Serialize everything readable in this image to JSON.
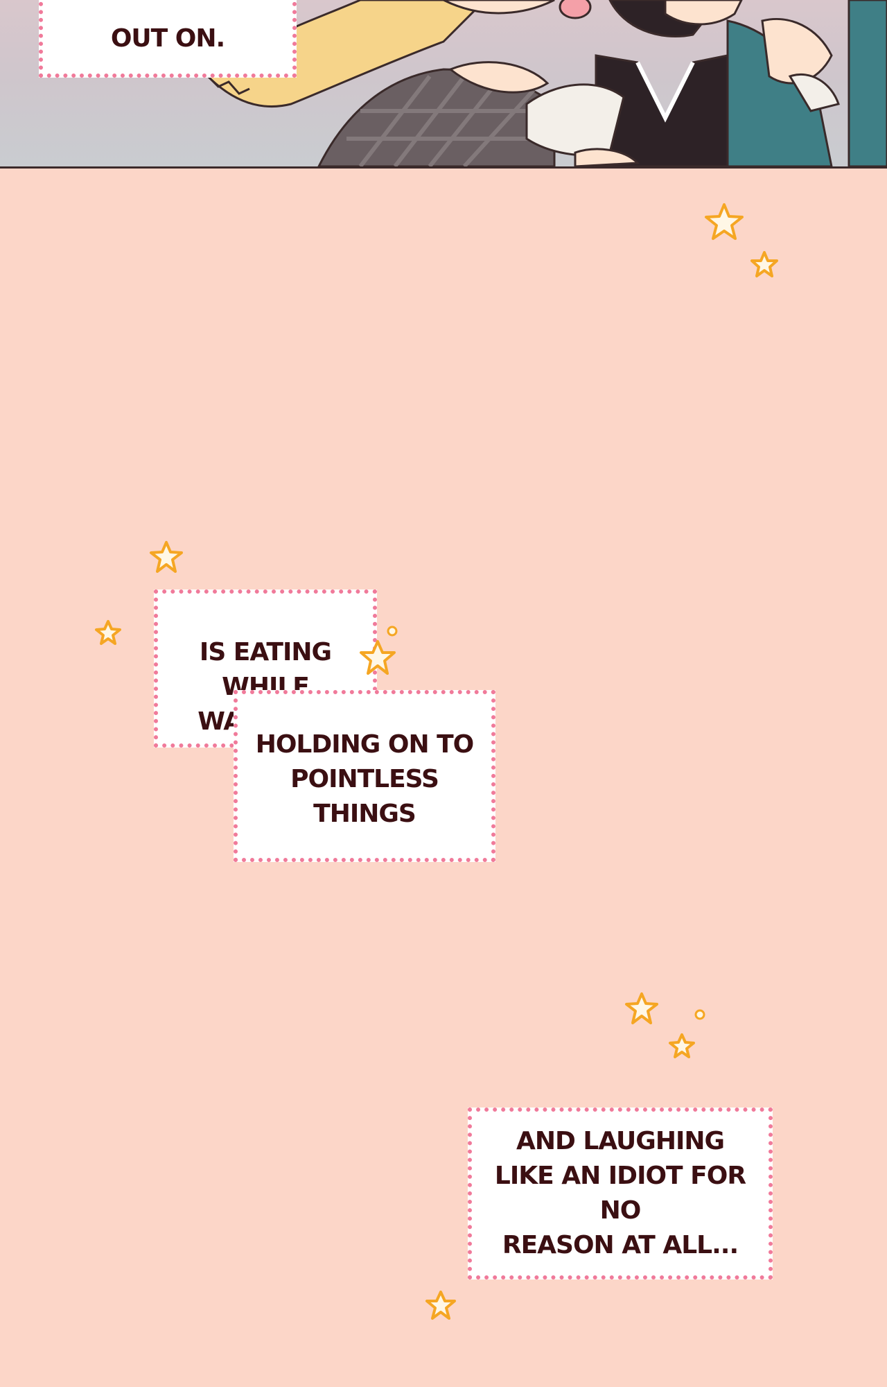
{
  "captions": {
    "top": "OUT ON.",
    "eating": "IS EATING\nWHILE WALKING,",
    "holding": "HOLDING ON TO\nPOINTLESS THINGS",
    "laughing": "AND LAUGHING\nLIKE AN IDIOT FOR NO\nREASON AT ALL..."
  },
  "colors": {
    "background": "#fcd6c8",
    "caption_border": "#f07a9a",
    "caption_text": "#3b0f12",
    "star_outline": "#f5a623"
  },
  "decorations": [
    "star-icon",
    "sparkle-icon",
    "dot-icon"
  ]
}
